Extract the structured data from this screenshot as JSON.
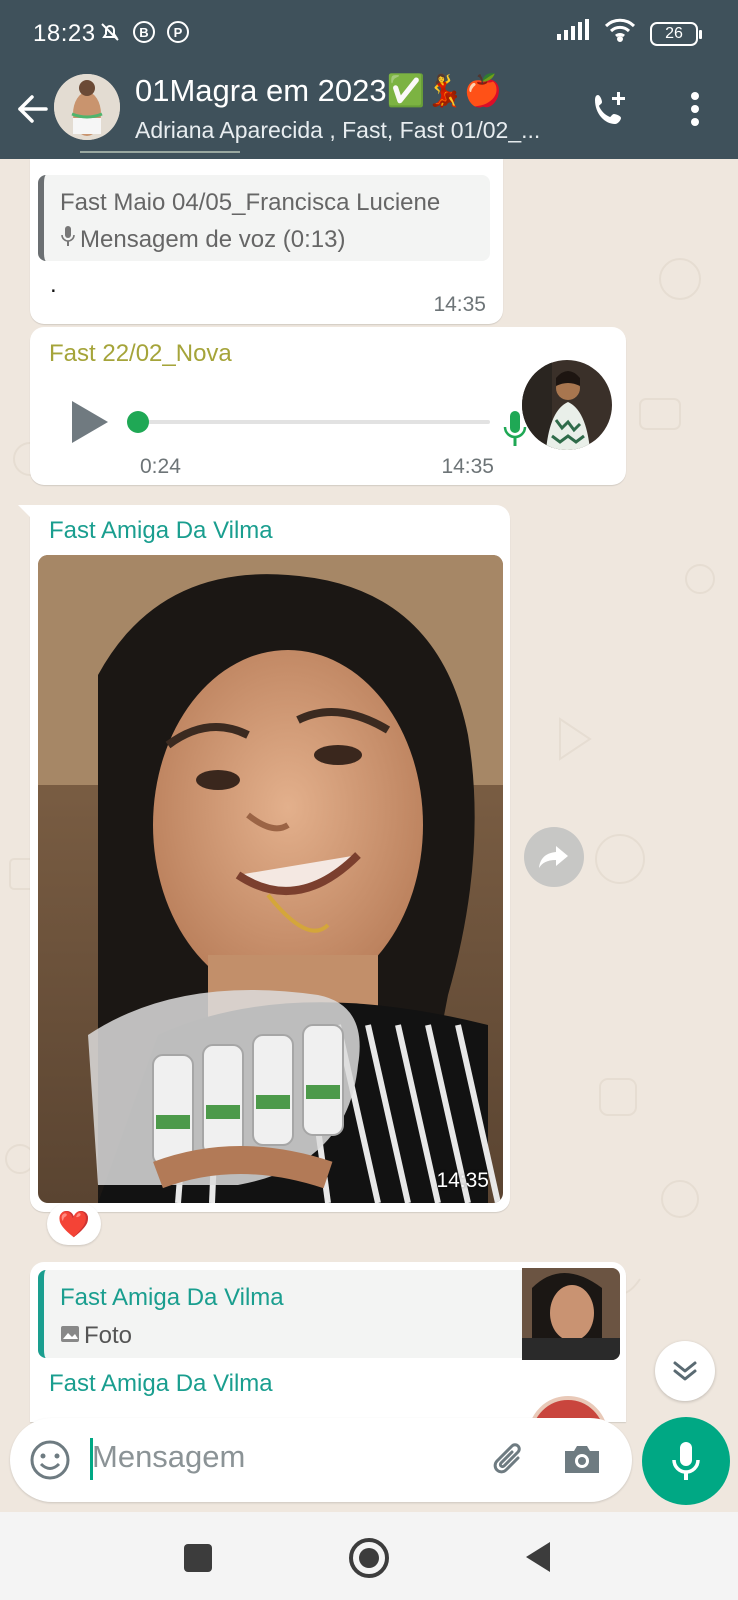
{
  "status_bar": {
    "time": "18:23",
    "battery": "26"
  },
  "header": {
    "title": "01Magra em 2023✅💃🍎",
    "subtitle": "Adriana Aparecida , Fast, Fast 01/02_..."
  },
  "messages": {
    "m1": {
      "quoted_sender": "Fast Maio 04/05_Francisca Luciene",
      "quoted_text": "Mensagem de voz (0:13)",
      "body": ".",
      "time": "14:35"
    },
    "m2": {
      "sender": "Fast 22/02_Nova",
      "duration": "0:24",
      "time": "14:35",
      "progress": 0
    },
    "m3": {
      "sender": "Fast Amiga Da Vilma",
      "time": "14:35",
      "reaction": "❤️"
    },
    "m4": {
      "quoted_sender": "Fast Amiga Da Vilma",
      "quoted_text": "Foto",
      "sender": "Fast Amiga Da Vilma"
    }
  },
  "composer": {
    "placeholder": "Mensagem"
  },
  "colors": {
    "header": "#3f515b",
    "accent": "#00a884",
    "chat_bg": "#efe7de",
    "sender_olive": "#a5a43a",
    "sender_teal": "#1a9e8f"
  }
}
